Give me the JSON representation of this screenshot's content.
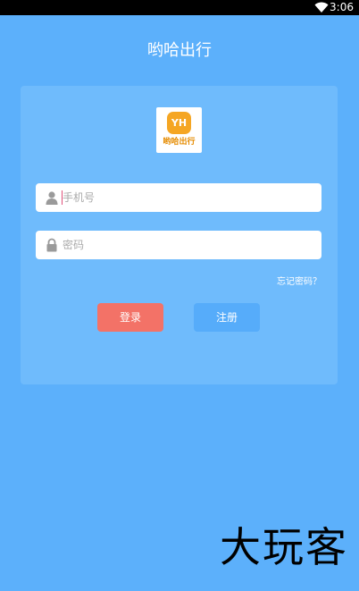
{
  "status_bar": {
    "time": "3:06"
  },
  "header": {
    "title": "哟哈出行"
  },
  "logo": {
    "badge": "YH",
    "text": "哟哈出行"
  },
  "form": {
    "phone_placeholder": "手机号",
    "password_placeholder": "密码",
    "forgot_label": "忘记密码？",
    "login_label": "登录",
    "register_label": "注册"
  },
  "icons": {
    "phone_field": "user-icon",
    "password_field": "lock-icon",
    "status": "wifi-icon"
  },
  "watermark": "大玩客"
}
